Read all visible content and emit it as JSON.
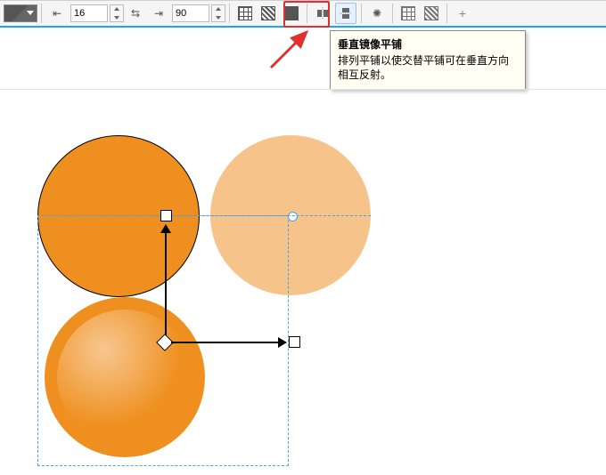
{
  "toolbar": {
    "offset1_value": "16",
    "offset2_value": "90",
    "mirror_h_title": "水平镜像平铺",
    "mirror_v_title": "垂直镜像平铺",
    "rotate_title": "旋转"
  },
  "tooltip": {
    "title": "垂直镜像平铺",
    "body": "排列平铺以使交替平铺可在垂直方向相互反射。"
  },
  "colors": {
    "accent": "#1aa7ee",
    "highlight": "#e03030",
    "circle_solid": "#ef8f1f",
    "circle_light": "#f6c38b",
    "selection": "#4aa3e6"
  }
}
